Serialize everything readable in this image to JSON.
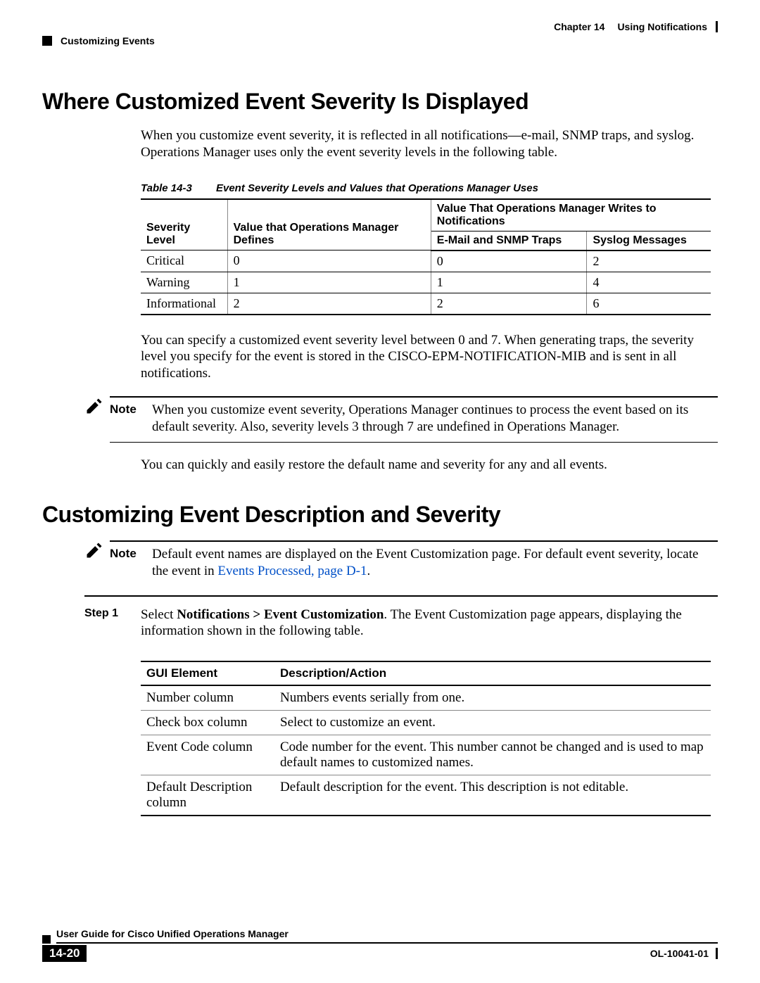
{
  "header": {
    "chapter": "Chapter 14",
    "chapterTitle": "Using Notifications",
    "section": "Customizing Events"
  },
  "section1": {
    "title": "Where Customized Event Severity Is Displayed",
    "intro": "When you customize event severity, it is reflected in all notifications—e-mail, SNMP traps, and syslog. Operations Manager uses only the event severity levels in the following table.",
    "tableCaptionNum": "Table 14-3",
    "tableCaptionText": "Event Severity Levels and Values that Operations Manager Uses",
    "headers": {
      "sev": "Severity Level",
      "val": "Value that Operations Manager Defines",
      "valWrite": "Value That Operations Manager Writes to Notifications",
      "email": "E-Mail and SNMP Traps",
      "syslog": "Syslog Messages"
    },
    "rows": [
      {
        "sev": "Critical",
        "v": "0",
        "e": "0",
        "s": "2"
      },
      {
        "sev": "Warning",
        "v": "1",
        "e": "1",
        "s": "4"
      },
      {
        "sev": "Informational",
        "v": "2",
        "e": "2",
        "s": "6"
      }
    ],
    "afterTable": "You can specify a customized event severity level between 0 and 7. When generating traps, the severity level you specify for the event is stored in the CISCO-EPM-NOTIFICATION-MIB and is sent in all notifications.",
    "noteLabel": "Note",
    "noteText": "When you customize event severity, Operations Manager continues to process the event based on its default severity. Also, severity levels 3 through 7 are undefined in Operations Manager.",
    "afterNote": "You can quickly and easily restore the default name and severity for any and all events."
  },
  "section2": {
    "title": "Customizing Event Description and Severity",
    "noteLabel": "Note",
    "noteTextPre": "Default event names are displayed on the Event Customization page. For default event severity, locate the event in ",
    "noteLink": "Events Processed, page D-1",
    "noteTextPost": ".",
    "stepLabel": "Step 1",
    "stepPre": "Select ",
    "stepBold": "Notifications > Event Customization",
    "stepPost": ". The Event Customization page appears, displaying the information shown in the following table.",
    "guiHeaders": {
      "el": "GUI Element",
      "desc": "Description/Action"
    },
    "guiRows": [
      {
        "el": "Number column",
        "desc": "Numbers events serially from one."
      },
      {
        "el": "Check box column",
        "desc": "Select to customize an event."
      },
      {
        "el": "Event Code column",
        "desc": "Code number for the event. This number cannot be changed and is used to map default names to customized names."
      },
      {
        "el": "Default Description column",
        "desc": "Default description for the event. This description is not editable."
      }
    ]
  },
  "footer": {
    "guide": "User Guide for Cisco Unified Operations Manager",
    "pageNum": "14-20",
    "docId": "OL-10041-01"
  }
}
